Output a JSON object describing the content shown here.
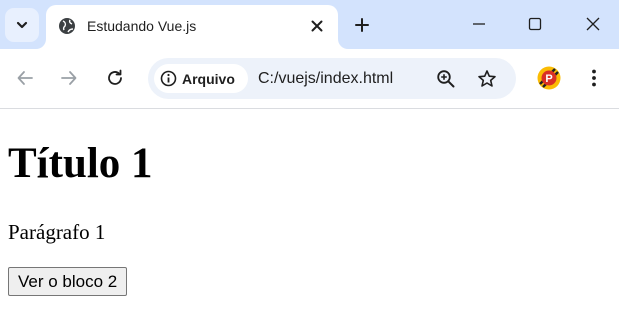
{
  "browser": {
    "tab": {
      "title": "Estudando Vue.js"
    },
    "security_chip": {
      "label": "Arquivo"
    },
    "address": {
      "url": "C:/vuejs/index.html"
    },
    "profile": {
      "initial": "P"
    },
    "icons": {
      "tab_search": "chevron-down-icon",
      "favicon": "globe-icon",
      "tab_close": "close-icon",
      "new_tab": "plus-icon",
      "minimize": "minimize-icon",
      "maximize": "maximize-icon",
      "close_window": "close-icon",
      "back": "arrow-left-icon",
      "forward": "arrow-right-icon",
      "reload": "reload-icon",
      "info": "info-icon",
      "zoom": "zoom-in-icon",
      "bookmark": "star-icon",
      "menu": "kebab-menu-icon"
    },
    "colors": {
      "tabstrip": "#d3e3fd",
      "omnibox": "#edf2fa"
    }
  },
  "page": {
    "heading": "Título 1",
    "paragraph": "Parágrafo 1",
    "button_label": "Ver o bloco 2"
  }
}
